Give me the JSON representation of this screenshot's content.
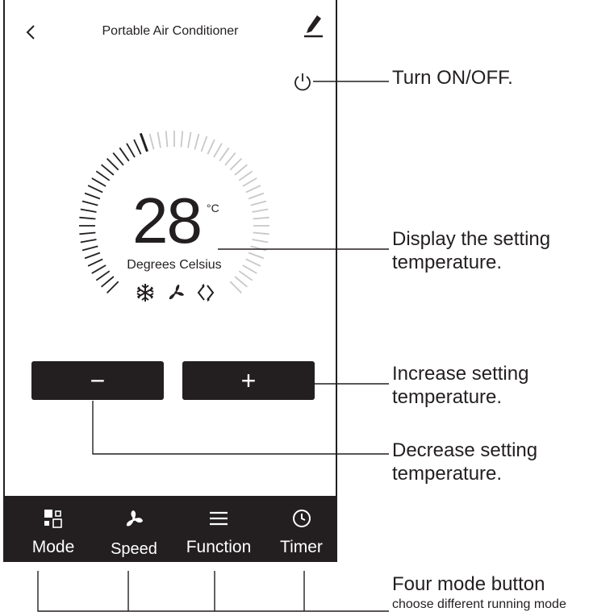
{
  "header": {
    "title": "Portable Air Conditioner",
    "back_icon": "chevron-left-icon",
    "edit_icon": "pencil-icon"
  },
  "power": {
    "icon": "power-icon"
  },
  "temperature": {
    "value": "28",
    "unit": "°C",
    "label": "Degrees Celsius",
    "status_icons": [
      "snowflake-icon",
      "fan-icon",
      "swing-icon"
    ]
  },
  "controls": {
    "decrease_label": "−",
    "increase_label": "+"
  },
  "tabs": [
    {
      "label": "Mode",
      "icon": "mode-grid-icon"
    },
    {
      "label": "Speed",
      "icon": "fan-speed-icon"
    },
    {
      "label": "Function",
      "icon": "menu-icon"
    },
    {
      "label": "Timer",
      "icon": "clock-icon"
    }
  ],
  "annotations": {
    "power": "Turn ON/OFF.",
    "display_line1": "Display the setting",
    "display_line2": "temperature.",
    "increase_line1": "Increase setting",
    "increase_line2": "temperature.",
    "decrease_line1": "Decrease setting",
    "decrease_line2": "temperature.",
    "modes_title": "Four mode button",
    "modes_sub": "choose different running mode"
  },
  "colors": {
    "dark": "#231f20",
    "light_tick": "#c8c8c8",
    "background": "#ffffff"
  }
}
